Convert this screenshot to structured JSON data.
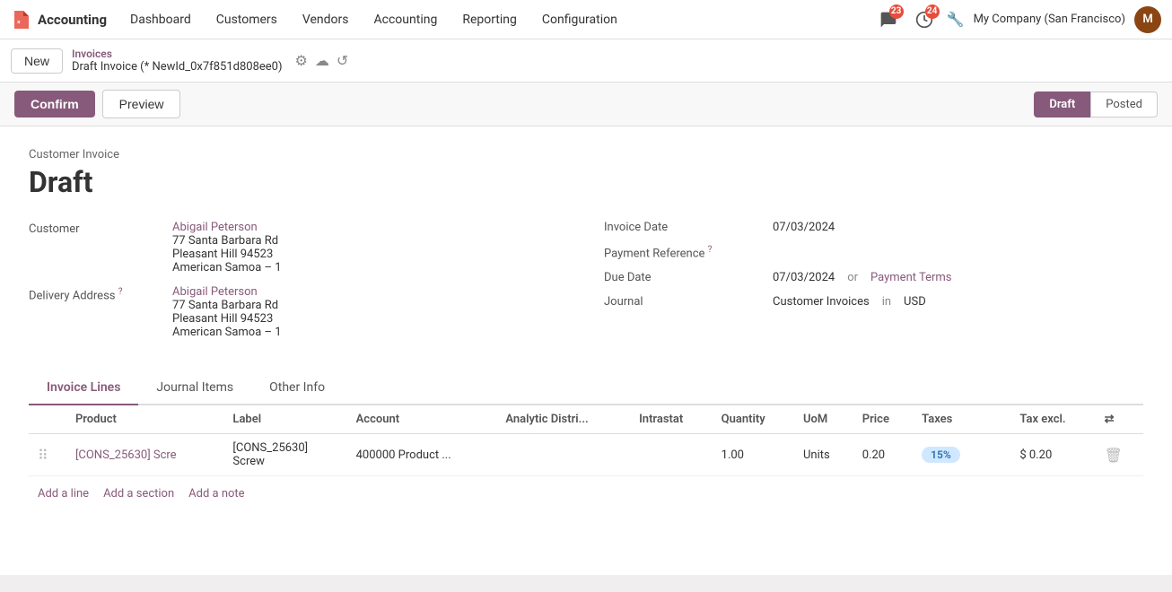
{
  "topnav": {
    "app_name": "Accounting",
    "links": [
      "Dashboard",
      "Customers",
      "Vendors",
      "Accounting",
      "Reporting",
      "Configuration"
    ],
    "notifications_count": "23",
    "activities_count": "24",
    "company": "My Company (San Francisco)",
    "avatar_initials": "M"
  },
  "breadcrumb": {
    "new_label": "New",
    "parent_label": "Invoices",
    "current_label": "Draft Invoice (* NewId_0x7f851d808ee0)"
  },
  "action_bar": {
    "confirm_label": "Confirm",
    "preview_label": "Preview",
    "status_draft": "Draft",
    "status_posted": "Posted"
  },
  "invoice": {
    "title_label": "Customer Invoice",
    "title": "Draft",
    "customer_label": "Customer",
    "customer_name": "Abigail Peterson",
    "customer_address1": "77 Santa Barbara Rd",
    "customer_address2": "Pleasant Hill 94523",
    "customer_address3": "American Samoa – 1",
    "delivery_label": "Delivery Address",
    "delivery_name": "Abigail Peterson",
    "delivery_address1": "77 Santa Barbara Rd",
    "delivery_address2": "Pleasant Hill 94523",
    "delivery_address3": "American Samoa – 1",
    "invoice_date_label": "Invoice Date",
    "invoice_date": "07/03/2024",
    "payment_ref_label": "Payment Reference",
    "payment_ref": "",
    "due_date_label": "Due Date",
    "due_date": "07/03/2024",
    "or_text": "or",
    "payment_terms_label": "Payment Terms",
    "journal_label": "Journal",
    "journal_value": "Customer Invoices",
    "in_text": "in",
    "currency": "USD"
  },
  "tabs": {
    "items": [
      {
        "label": "Invoice Lines",
        "active": true
      },
      {
        "label": "Journal Items",
        "active": false
      },
      {
        "label": "Other Info",
        "active": false
      }
    ]
  },
  "table": {
    "columns": [
      "",
      "Product",
      "Label",
      "Account",
      "Analytic Distri...",
      "Intrastat",
      "Quantity",
      "UoM",
      "Price",
      "Taxes",
      "",
      "Tax excl.",
      ""
    ],
    "rows": [
      {
        "drag": "⠿",
        "product": "[CONS_25630] Scre",
        "label_line1": "[CONS_25630]",
        "label_line2": "Screw",
        "account": "400000 Product ...",
        "analytic": "",
        "intrastat": "",
        "quantity": "1.00",
        "uom": "Units",
        "price": "0.20",
        "tax": "15%",
        "tax_excl": "$ 0.20"
      }
    ]
  },
  "footer": {
    "add_line_label": "Add a line",
    "add_section_label": "Add a section",
    "add_note_label": "Add a note"
  }
}
